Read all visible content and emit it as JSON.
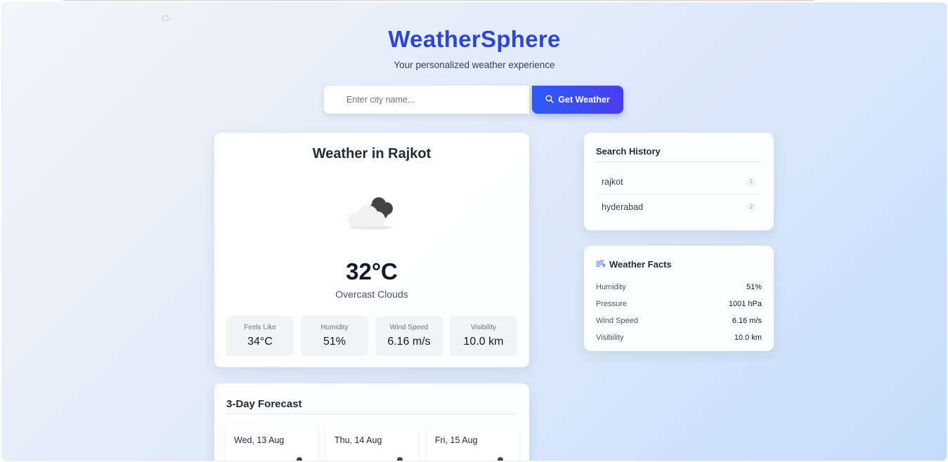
{
  "header": {
    "title": "WeatherSphere",
    "subtitle": "Your personalized weather experience"
  },
  "search": {
    "placeholder": "Enter city name...",
    "value": "",
    "button_label": "Get Weather"
  },
  "current": {
    "title": "Weather in Rajkot",
    "icon": "cloud-icon",
    "temperature": "32°C",
    "description": "Overcast Clouds",
    "stats": [
      {
        "label": "Feels Like",
        "value": "34°C"
      },
      {
        "label": "Humidity",
        "value": "51%"
      },
      {
        "label": "Wind Speed",
        "value": "6.16 m/s"
      },
      {
        "label": "Visibility",
        "value": "10.0 km"
      }
    ]
  },
  "forecast": {
    "title": "3-Day Forecast",
    "days": [
      {
        "date": "Wed, 13 Aug"
      },
      {
        "date": "Thu, 14 Aug"
      },
      {
        "date": "Fri, 15 Aug"
      }
    ]
  },
  "history": {
    "title": "Search History",
    "items": [
      {
        "city": "rajkot",
        "count": "1"
      },
      {
        "city": "hyderabad",
        "count": "2"
      }
    ]
  },
  "facts": {
    "title": "Weather Facts",
    "icon": "wind-icon",
    "rows": [
      {
        "label": "Humidity",
        "value": "51%"
      },
      {
        "label": "Pressure",
        "value": "1001 hPa"
      },
      {
        "label": "Wind Speed",
        "value": "6.16 m/s"
      },
      {
        "label": "Visibility",
        "value": "10.0 km"
      }
    ]
  },
  "colors": {
    "brand": "#2f45d9",
    "button_start": "#2d5bf5",
    "button_end": "#4a3ef0"
  }
}
